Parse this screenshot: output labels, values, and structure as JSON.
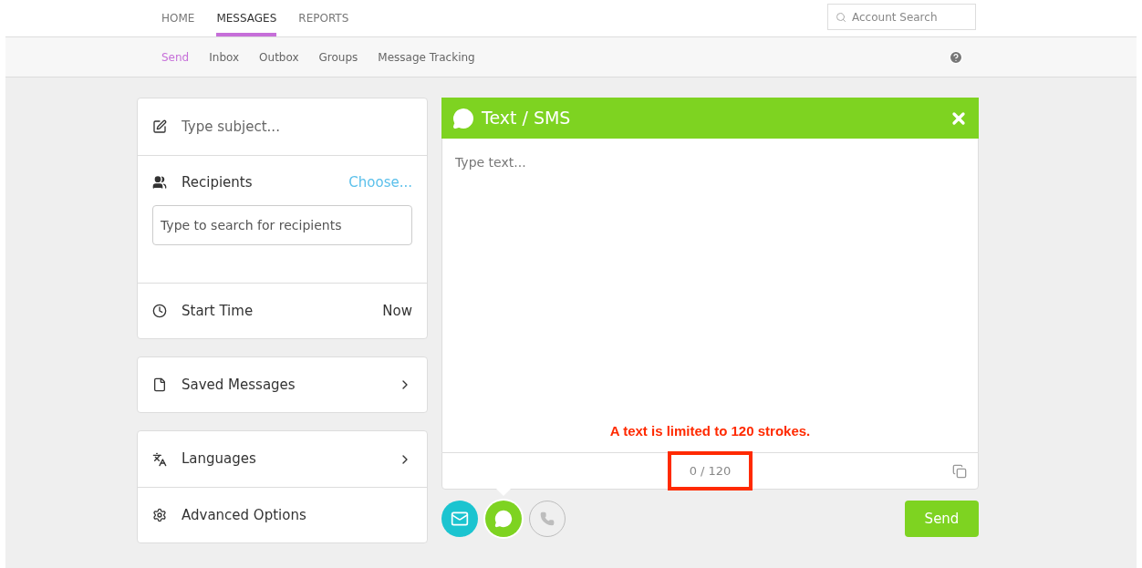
{
  "top_nav": {
    "tabs": [
      {
        "label": "HOME",
        "selected": false
      },
      {
        "label": "MESSAGES",
        "selected": true
      },
      {
        "label": "REPORTS",
        "selected": false
      }
    ],
    "search": {
      "placeholder": "Account Search"
    }
  },
  "sub_nav": {
    "tabs": [
      {
        "label": "Send",
        "selected": true
      },
      {
        "label": "Inbox",
        "selected": false
      },
      {
        "label": "Outbox",
        "selected": false
      },
      {
        "label": "Groups",
        "selected": false
      },
      {
        "label": "Message Tracking",
        "selected": false
      }
    ]
  },
  "subject": {
    "placeholder": "Type subject..."
  },
  "recipients": {
    "label": "Recipients",
    "action": "Choose...",
    "search": {
      "placeholder": "Type to search for recipients"
    }
  },
  "start_time": {
    "label": "Start Time",
    "value": "Now"
  },
  "saved_messages": {
    "label": "Saved Messages"
  },
  "options": [
    {
      "kind": "languages",
      "label": "Languages",
      "chevron": true
    },
    {
      "kind": "advanced",
      "label": "Advanced Options",
      "chevron": false
    }
  ],
  "composer": {
    "title": "Text / SMS",
    "placeholder": "Type text...",
    "annotation": "A text is limited to 120 strokes.",
    "counter": "0 / 120",
    "counter_highlighted": true
  },
  "channels": [
    {
      "kind": "email",
      "enabled": true,
      "selected": false,
      "color": "#1bc4d0"
    },
    {
      "kind": "sms",
      "enabled": true,
      "selected": true,
      "color": "#7ed321"
    },
    {
      "kind": "voice",
      "enabled": false,
      "selected": false,
      "color": "#bdbdbd"
    }
  ],
  "send_button": "Send"
}
